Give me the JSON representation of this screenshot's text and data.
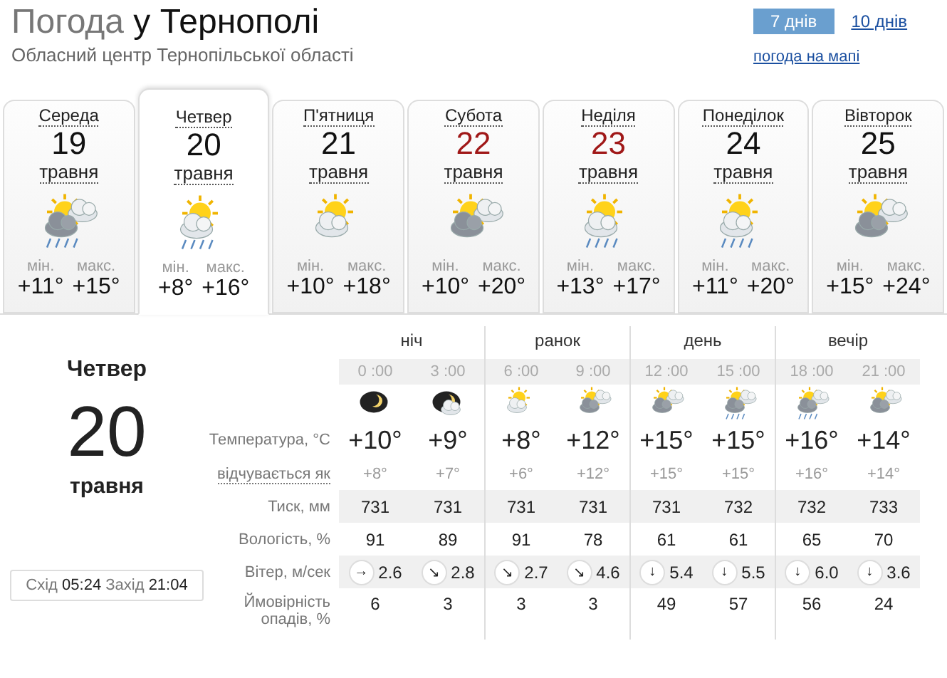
{
  "header": {
    "title_prefix": "Погода",
    "title_city": "у Тернополі",
    "subtitle": "Обласний центр Тернопільської області"
  },
  "nav": [
    {
      "label": "7 днів",
      "selected": true
    },
    {
      "label": "10 днів",
      "selected": false
    }
  ],
  "map_link": "погода на мапі",
  "days": [
    {
      "name": "Середа",
      "date": "19",
      "month": "травня",
      "weekend": false,
      "selected": false,
      "kind": "shower",
      "min_label": "мін.",
      "max_label": "макс.",
      "min": "+11°",
      "max": "+15°"
    },
    {
      "name": "Четвер",
      "date": "20",
      "month": "травня",
      "weekend": false,
      "selected": true,
      "kind": "rain",
      "min_label": "мін.",
      "max_label": "макс.",
      "min": "+8°",
      "max": "+16°"
    },
    {
      "name": "П'ятниця",
      "date": "21",
      "month": "травня",
      "weekend": false,
      "selected": false,
      "kind": "partly",
      "min_label": "мін.",
      "max_label": "макс.",
      "min": "+10°",
      "max": "+18°"
    },
    {
      "name": "Субота",
      "date": "22",
      "month": "травня",
      "weekend": true,
      "selected": false,
      "kind": "cloudy",
      "min_label": "мін.",
      "max_label": "макс.",
      "min": "+10°",
      "max": "+20°"
    },
    {
      "name": "Неділя",
      "date": "23",
      "month": "травня",
      "weekend": true,
      "selected": false,
      "kind": "rain",
      "min_label": "мін.",
      "max_label": "макс.",
      "min": "+13°",
      "max": "+17°"
    },
    {
      "name": "Понеділок",
      "date": "24",
      "month": "травня",
      "weekend": false,
      "selected": false,
      "kind": "rain",
      "min_label": "мін.",
      "max_label": "макс.",
      "min": "+11°",
      "max": "+20°"
    },
    {
      "name": "Вівторок",
      "date": "25",
      "month": "травня",
      "weekend": false,
      "selected": false,
      "kind": "cloudy",
      "min_label": "мін.",
      "max_label": "макс.",
      "min": "+15°",
      "max": "+24°"
    }
  ],
  "detail": {
    "day_name": "Четвер",
    "date": "20",
    "month": "травня",
    "sun": "Схід **05:24** Захід **21:04**",
    "row_labels": {
      "temperature": "Температура, °C",
      "feels_like": "відчувається як",
      "pressure": "Тиск, мм",
      "humidity": "Вологість, %",
      "wind": "Вітер, м/сек",
      "precipitation": "Ймовірність опадів, %"
    },
    "periods": [
      "ніч",
      "ранок",
      "день",
      "вечір"
    ],
    "hours": [
      {
        "time": "0 :00",
        "kind": "night",
        "temp": "+10°",
        "feels": "+8°",
        "pressure": "731",
        "humidity": "91",
        "wind_dir": "→",
        "wind": "2.6",
        "precip": "6"
      },
      {
        "time": "3 :00",
        "kind": "night-cloudy",
        "temp": "+9°",
        "feels": "+7°",
        "pressure": "731",
        "humidity": "89",
        "wind_dir": "↘",
        "wind": "2.8",
        "precip": "3"
      },
      {
        "time": "6 :00",
        "kind": "partly",
        "temp": "+8°",
        "feels": "+6°",
        "pressure": "731",
        "humidity": "91",
        "wind_dir": "↘",
        "wind": "2.7",
        "precip": "3"
      },
      {
        "time": "9 :00",
        "kind": "cloudy",
        "temp": "+12°",
        "feels": "+12°",
        "pressure": "731",
        "humidity": "78",
        "wind_dir": "↘",
        "wind": "4.6",
        "precip": "3"
      },
      {
        "time": "12 :00",
        "kind": "cloudy",
        "temp": "+15°",
        "feels": "+15°",
        "pressure": "731",
        "humidity": "61",
        "wind_dir": "↓",
        "wind": "5.4",
        "precip": "49"
      },
      {
        "time": "15 :00",
        "kind": "shower",
        "temp": "+15°",
        "feels": "+15°",
        "pressure": "732",
        "humidity": "61",
        "wind_dir": "↓",
        "wind": "5.5",
        "precip": "57"
      },
      {
        "time": "18 :00",
        "kind": "shower",
        "temp": "+16°",
        "feels": "+16°",
        "pressure": "732",
        "humidity": "65",
        "wind_dir": "↓",
        "wind": "6.0",
        "precip": "56"
      },
      {
        "time": "21 :00",
        "kind": "cloudy",
        "temp": "+14°",
        "feels": "+14°",
        "pressure": "733",
        "humidity": "70",
        "wind_dir": "↓",
        "wind": "3.6",
        "precip": "24"
      }
    ]
  }
}
